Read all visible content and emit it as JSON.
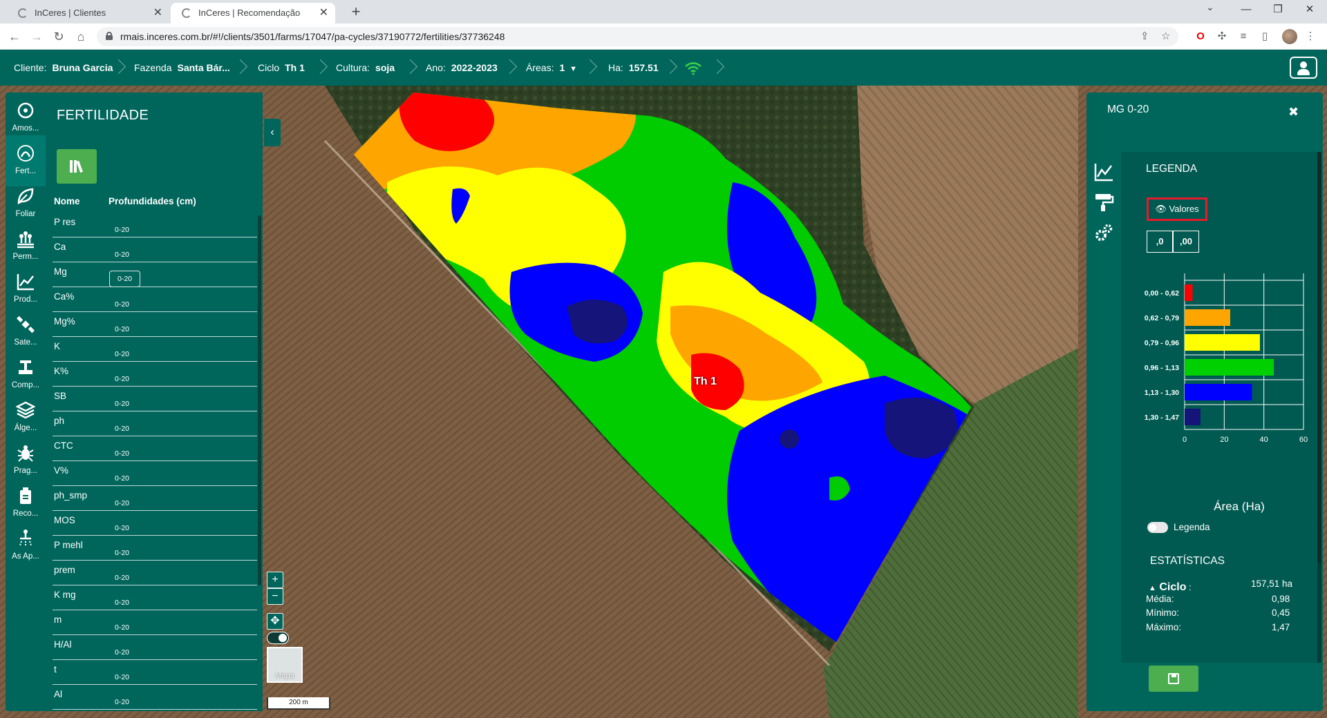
{
  "browser": {
    "tabs": [
      {
        "title": "InCeres | Clientes",
        "active": false
      },
      {
        "title": "InCeres | Recomendação",
        "active": true
      }
    ],
    "url": "rmais.inceres.com.br/#!/clients/3501/farms/17047/pa-cycles/37190772/fertilities/37736248"
  },
  "header": {
    "cliente_label": "Cliente:",
    "cliente": "Bruna Garcia",
    "fazenda_label": "Fazenda",
    "fazenda": "Santa Bár...",
    "ciclo_label": "Ciclo",
    "ciclo": "Th 1",
    "cultura_label": "Cultura:",
    "cultura": "soja",
    "ano_label": "Ano:",
    "ano": "2022-2023",
    "areas_label": "Áreas:",
    "areas": "1",
    "ha_label": "Ha:",
    "ha": "157.51"
  },
  "rail": [
    {
      "label": "Amos...",
      "icon": "samples-icon"
    },
    {
      "label": "Fert...",
      "icon": "fertility-icon",
      "active": true
    },
    {
      "label": "Foliar",
      "icon": "leaf-icon"
    },
    {
      "label": "Perm...",
      "icon": "crops-icon"
    },
    {
      "label": "Prod...",
      "icon": "productivity-chart-icon"
    },
    {
      "label": "Sate...",
      "icon": "satellite-icon"
    },
    {
      "label": "Comp...",
      "icon": "compaction-icon"
    },
    {
      "label": "Álge...",
      "icon": "layers-icon"
    },
    {
      "label": "Prag...",
      "icon": "pest-icon"
    },
    {
      "label": "Reco...",
      "icon": "recommendation-icon"
    },
    {
      "label": "As Ap...",
      "icon": "sprayer-icon"
    }
  ],
  "panel": {
    "title": "FERTILIDADE",
    "col_name": "Nome",
    "col_depth": "Profundidades (cm)",
    "rows": [
      {
        "name": "P res",
        "depth": "0-20"
      },
      {
        "name": "Ca",
        "depth": "0-20"
      },
      {
        "name": "Mg",
        "depth": "0-20",
        "selected": true
      },
      {
        "name": "Ca%",
        "depth": "0-20"
      },
      {
        "name": "Mg%",
        "depth": "0-20"
      },
      {
        "name": "K",
        "depth": "0-20"
      },
      {
        "name": "K%",
        "depth": "0-20"
      },
      {
        "name": "SB",
        "depth": "0-20"
      },
      {
        "name": "ph",
        "depth": "0-20"
      },
      {
        "name": "CTC",
        "depth": "0-20"
      },
      {
        "name": "V%",
        "depth": "0-20"
      },
      {
        "name": "ph_smp",
        "depth": "0-20"
      },
      {
        "name": "MOS",
        "depth": "0-20"
      },
      {
        "name": "P mehl",
        "depth": "0-20"
      },
      {
        "name": "prem",
        "depth": "0-20"
      },
      {
        "name": "K mg",
        "depth": "0-20"
      },
      {
        "name": "m",
        "depth": "0-20"
      },
      {
        "name": "H/Al",
        "depth": "0-20"
      },
      {
        "name": "t",
        "depth": "0-20"
      },
      {
        "name": "Al",
        "depth": "0-20"
      }
    ]
  },
  "map": {
    "field_label": "Th 1",
    "thumb_label": "Mapa",
    "scale_label": "200 m",
    "zoom_in": "+",
    "zoom_out": "−"
  },
  "right_panel": {
    "title": "MG 0-20",
    "legend_title": "LEGENDA",
    "valores_label": "Valores",
    "dec_labels": [
      ",0",
      ",00"
    ],
    "legend_toggle_label": "Legenda",
    "stats_title": "ESTATÍSTICAS",
    "stats": {
      "ciclo_label": "Ciclo",
      "ciclo_value": "157,51 ha",
      "media_label": "Média:",
      "media_value": "0,98",
      "minimo_label": "Mínimo:",
      "minimo_value": "0,45",
      "maximo_label": "Máximo:",
      "maximo_value": "1,47"
    }
  },
  "colors": {
    "brand": "#00665c",
    "class_colors": [
      "#ff0000",
      "#ffa500",
      "#ffff00",
      "#00d000",
      "#0000ff",
      "#14147a"
    ]
  },
  "chart_data": {
    "type": "bar",
    "orientation": "horizontal",
    "categories": [
      "0,00 - 0,62",
      "0,62 - 0,79",
      "0,79 - 0,96",
      "0,96 - 1,13",
      "1,13 - 1,30",
      "1,30 - 1,47"
    ],
    "values": [
      4,
      23,
      38,
      45,
      34,
      8
    ],
    "xlabel": "Área (Ha)",
    "xlim": [
      0,
      60
    ],
    "xticks": [
      0,
      20,
      40,
      60
    ],
    "grid": true
  }
}
